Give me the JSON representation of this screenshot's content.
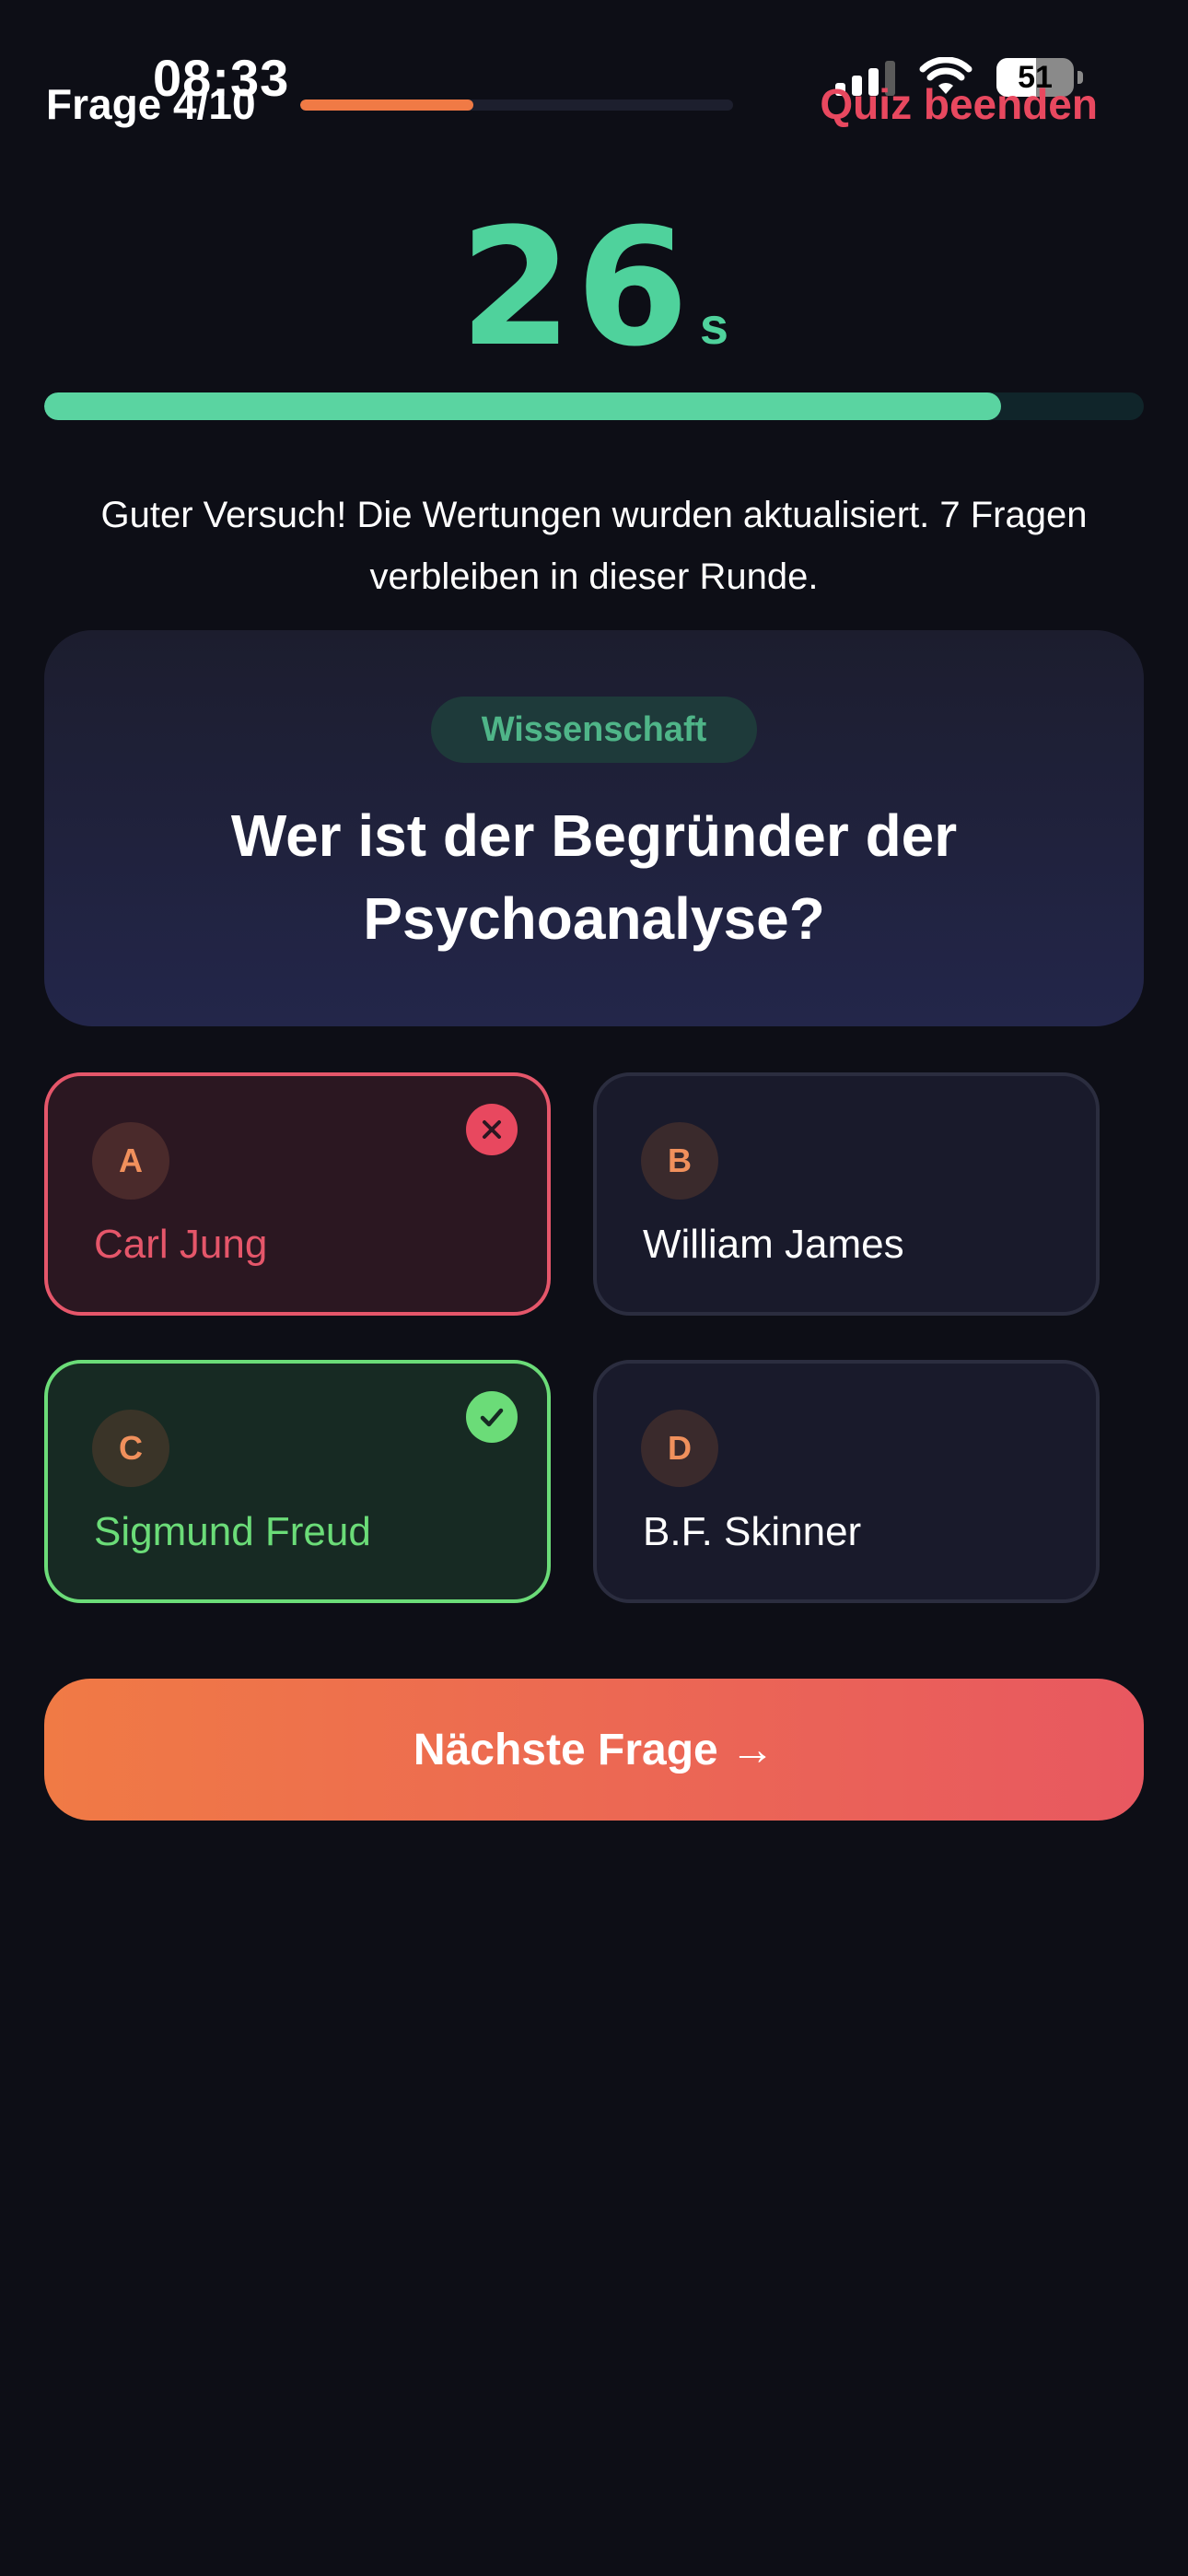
{
  "status_bar": {
    "time": "08:33",
    "battery": "51",
    "battery_level": 0.51
  },
  "header": {
    "question_counter": "Frage 4/10",
    "quiz_progress": 0.4,
    "end_quiz_label": "Quiz beenden",
    "accent_color": "#e8485f"
  },
  "timer": {
    "seconds": "26",
    "unit": "s",
    "remaining_fraction": 0.87,
    "color": "#4fd29c"
  },
  "feedback": {
    "text": "Guter Versuch! Die Wertungen wurden aktualisiert. 7 Fragen verbleiben in dieser Runde."
  },
  "question": {
    "category": "Wissenschaft",
    "text": "Wer ist der Begründer der Psychoanalyse?"
  },
  "answers": [
    {
      "letter": "A",
      "label": "Carl Jung",
      "state": "wrong",
      "icon": "x-icon"
    },
    {
      "letter": "B",
      "label": "William James",
      "state": "neutral"
    },
    {
      "letter": "C",
      "label": "Sigmund Freud",
      "state": "correct",
      "icon": "check-icon"
    },
    {
      "letter": "D",
      "label": "B.F. Skinner",
      "state": "neutral"
    }
  ],
  "next_button": {
    "label": "Nächste Frage →"
  }
}
